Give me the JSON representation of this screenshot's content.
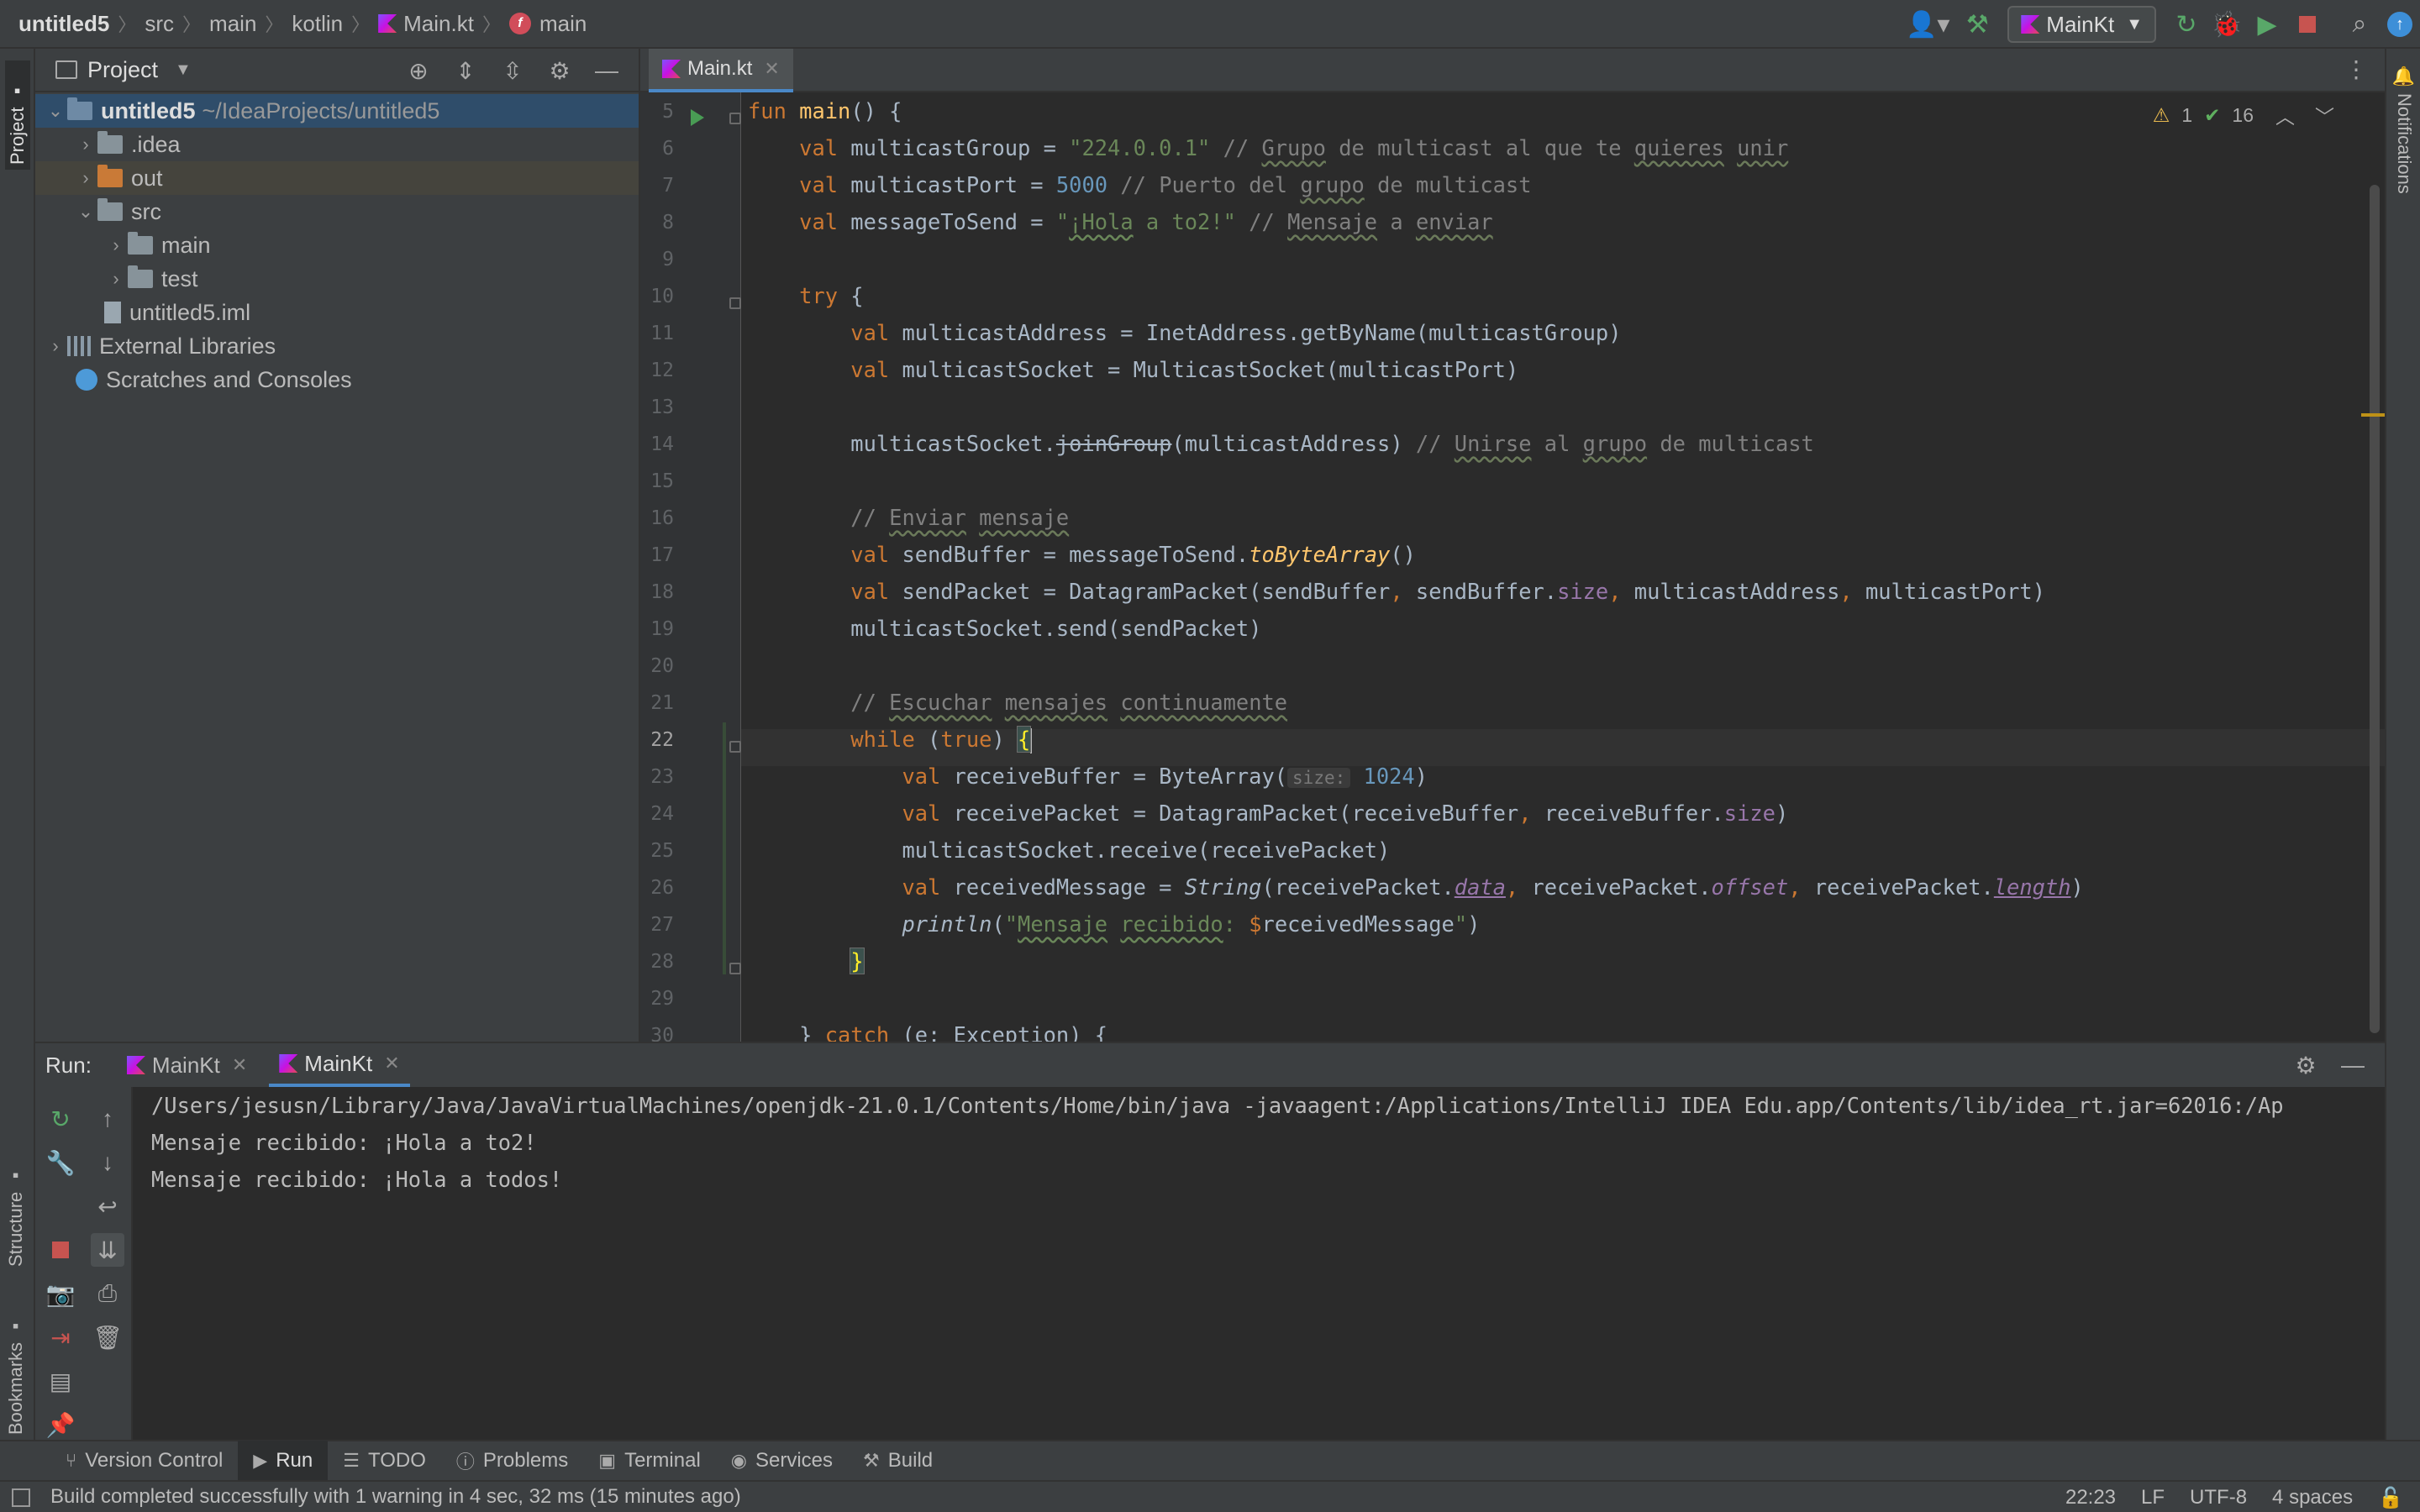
{
  "breadcrumb": {
    "items": [
      "untitled5",
      "src",
      "main",
      "kotlin",
      "Main.kt",
      "main"
    ]
  },
  "toolbar": {
    "run_config": "MainKt"
  },
  "left_strip": {
    "project": "Project",
    "structure": "Structure",
    "bookmarks": "Bookmarks"
  },
  "right_strip": {
    "notifications": "Notifications"
  },
  "project_panel": {
    "title": "Project",
    "tree": [
      {
        "label": "untitled5",
        "path": "~/IdeaProjects/untitled5"
      },
      {
        "label": ".idea"
      },
      {
        "label": "out"
      },
      {
        "label": "src"
      },
      {
        "label": "main"
      },
      {
        "label": "test"
      },
      {
        "label": "untitled5.iml"
      },
      {
        "label": "External Libraries"
      },
      {
        "label": "Scratches and Consoles"
      }
    ]
  },
  "editor": {
    "tab": "Main.kt",
    "inspections": {
      "warnings": "1",
      "ok": "16"
    },
    "line_numbers": [
      "5",
      "6",
      "7",
      "8",
      "9",
      "10",
      "11",
      "12",
      "13",
      "14",
      "15",
      "16",
      "17",
      "18",
      "19",
      "20",
      "21",
      "22",
      "23",
      "24",
      "25",
      "26",
      "27",
      "28",
      "29",
      "30"
    ],
    "current_line": "22",
    "code": {
      "l5_fun": "fun",
      "l5_name": "main",
      "l5_rest": "() {",
      "l6_val": "val",
      "l6_a": " multicastGroup = ",
      "l6_str": "\"224.0.0.1\"",
      "l6_c1": " // ",
      "l6_c2": "Grupo",
      "l6_c3": " de multicast al que te ",
      "l6_c4": "quieres",
      "l6_c5": " ",
      "l6_c6": "unir",
      "l7_val": "val",
      "l7_a": " multicastPort = ",
      "l7_num": "5000",
      "l7_c1": " // Puerto del ",
      "l7_c2": "grupo",
      "l7_c3": " de multicast",
      "l8_val": "val",
      "l8_a": " messageToSend = ",
      "l8_s1": "\"",
      "l8_s2": "¡Hola",
      "l8_s3": " a to2!\"",
      "l8_c1": " // ",
      "l8_c2": "Mensaje",
      "l8_c3": " a ",
      "l8_c4": "enviar",
      "l10_try": "try",
      "l10_rest": " {",
      "l11_val": "val",
      "l11_a": " multicastAddress = InetAddress.getByName(multicastGroup)",
      "l12_val": "val",
      "l12_a": " multicastSocket = MulticastSocket(multicastPort)",
      "l14_a": "multicastSocket.",
      "l14_b": "joinGroup",
      "l14_c": "(multicastAddress)",
      "l14_c1": " // ",
      "l14_c2": "Unirse",
      "l14_c3": " al ",
      "l14_c4": "grupo",
      "l14_c5": " de multicast",
      "l16_c1": "// ",
      "l16_c2": "Enviar",
      "l16_c3": " ",
      "l16_c4": "mensaje",
      "l17_val": "val",
      "l17_a": " sendBuffer = messageToSend.",
      "l17_b": "toByteArray",
      "l17_c": "()",
      "l18_val": "val",
      "l18_a": " sendPacket = DatagramPacket(sendBuffer",
      "l18_comma1": ",",
      "l18_b": " sendBuffer.",
      "l18_size": "size",
      "l18_comma2": ",",
      "l18_c": " multicastAddress",
      "l18_comma3": ",",
      "l18_d": " multicastPort)",
      "l19_a": "multicastSocket.send(sendPacket)",
      "l21_c1": "// ",
      "l21_c2": "Escuchar",
      "l21_c3": " ",
      "l21_c4": "mensajes",
      "l21_c5": " ",
      "l21_c6": "continuamente",
      "l22_while": "while",
      "l22_a": " (",
      "l22_true": "true",
      "l22_b": ") ",
      "l22_brace": "{",
      "l23_val": "val",
      "l23_a": " receiveBuffer = ByteArray(",
      "l23_hint": "size:",
      "l23_num": "1024",
      "l23_b": ")",
      "l24_val": "val",
      "l24_a": " receivePacket = DatagramPacket(receiveBuffer",
      "l24_comma": ",",
      "l24_b": " receiveBuffer.",
      "l24_size": "size",
      "l24_c": ")",
      "l25_a": "multicastSocket.receive(receivePacket)",
      "l26_val": "val",
      "l26_a": " receivedMessage = ",
      "l26_string": "String",
      "l26_b": "(receivePacket.",
      "l26_data": "data",
      "l26_comma1": ",",
      "l26_c": " receivePacket.",
      "l26_offset": "offset",
      "l26_comma2": ",",
      "l26_d": " receivePacket.",
      "l26_length": "length",
      "l26_e": ")",
      "l27_println": "println",
      "l27_a": "(",
      "l27_s1": "\"",
      "l27_s2": "Mensaje",
      "l27_s3": " ",
      "l27_s4": "recibido",
      "l27_s5": ": ",
      "l27_dollar": "$",
      "l27_var": "receivedMessage",
      "l27_s6": "\"",
      "l27_b": ")",
      "l28_brace": "}",
      "l30_a": "} ",
      "l30_catch": "catch",
      "l30_b": " (e: Exception) {"
    }
  },
  "run_panel": {
    "label": "Run:",
    "tabs": [
      "MainKt",
      "MainKt"
    ],
    "console": [
      "/Users/jesusn/Library/Java/JavaVirtualMachines/openjdk-21.0.1/Contents/Home/bin/java -javaagent:/Applications/IntelliJ IDEA Edu.app/Contents/lib/idea_rt.jar=62016:/Ap",
      "Mensaje recibido: ¡Hola a to2!",
      "Mensaje recibido: ¡Hola a todos!"
    ]
  },
  "bottom_tools": [
    "Version Control",
    "Run",
    "TODO",
    "Problems",
    "Terminal",
    "Services",
    "Build"
  ],
  "status": {
    "message": "Build completed successfully with 1 warning in 4 sec, 32 ms (15 minutes ago)",
    "position": "22:23",
    "line_sep": "LF",
    "encoding": "UTF-8",
    "indent": "4 spaces"
  }
}
